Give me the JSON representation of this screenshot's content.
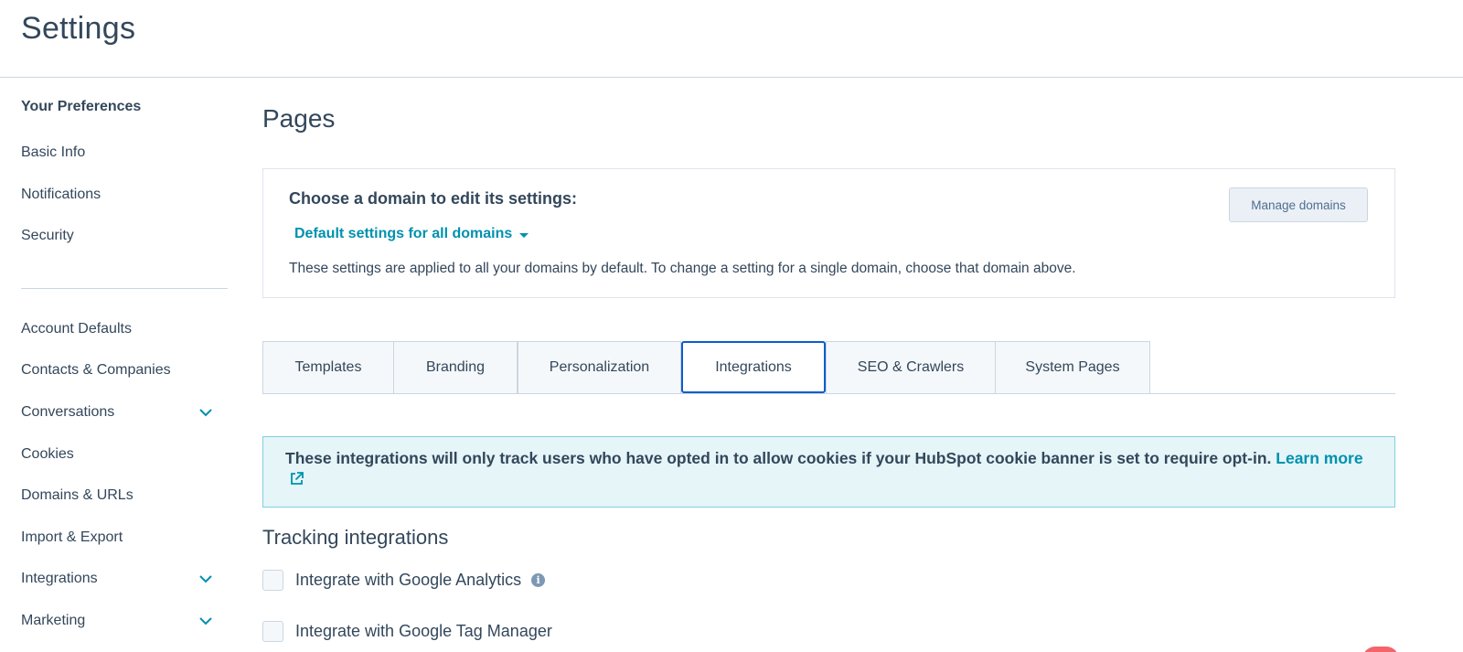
{
  "header": {
    "title": "Settings"
  },
  "sidebar": {
    "section_header": "Your Preferences",
    "preferences": [
      "Basic Info",
      "Notifications",
      "Security"
    ],
    "account_items": [
      {
        "label": "Account Defaults",
        "expandable": false
      },
      {
        "label": "Contacts & Companies",
        "expandable": false
      },
      {
        "label": "Conversations",
        "expandable": true
      },
      {
        "label": "Cookies",
        "expandable": false
      },
      {
        "label": "Domains & URLs",
        "expandable": false
      },
      {
        "label": "Import & Export",
        "expandable": false
      },
      {
        "label": "Integrations",
        "expandable": true
      },
      {
        "label": "Marketing",
        "expandable": true
      }
    ]
  },
  "main": {
    "page_title": "Pages",
    "domain_card": {
      "label": "Choose a domain to edit its settings:",
      "selected_domain": "Default settings for all domains",
      "description": "These settings are applied to all your domains by default. To change a setting for a single domain, choose that domain above.",
      "manage_button": "Manage domains"
    },
    "tabs": [
      {
        "label": "Templates",
        "active": false
      },
      {
        "label": "Branding",
        "active": false
      },
      {
        "label": "Personalization",
        "active": false
      },
      {
        "label": "Integrations",
        "active": true
      },
      {
        "label": "SEO & Crawlers",
        "active": false
      },
      {
        "label": "System Pages",
        "active": false
      }
    ],
    "alert": {
      "message": "These integrations will only track users who have opted in to allow cookies if your HubSpot cookie banner is set to require opt-in.",
      "link": "Learn more"
    },
    "tracking": {
      "title": "Tracking integrations",
      "options": [
        {
          "label": "Integrate with Google Analytics",
          "checked": false,
          "info": true
        },
        {
          "label": "Integrate with Google Tag Manager",
          "checked": false,
          "info": false
        }
      ]
    }
  },
  "colors": {
    "accent": "#0091ae",
    "active_tab_border": "#0b5dcc",
    "text": "#33475b",
    "alert_bg": "#e5f5f8"
  }
}
